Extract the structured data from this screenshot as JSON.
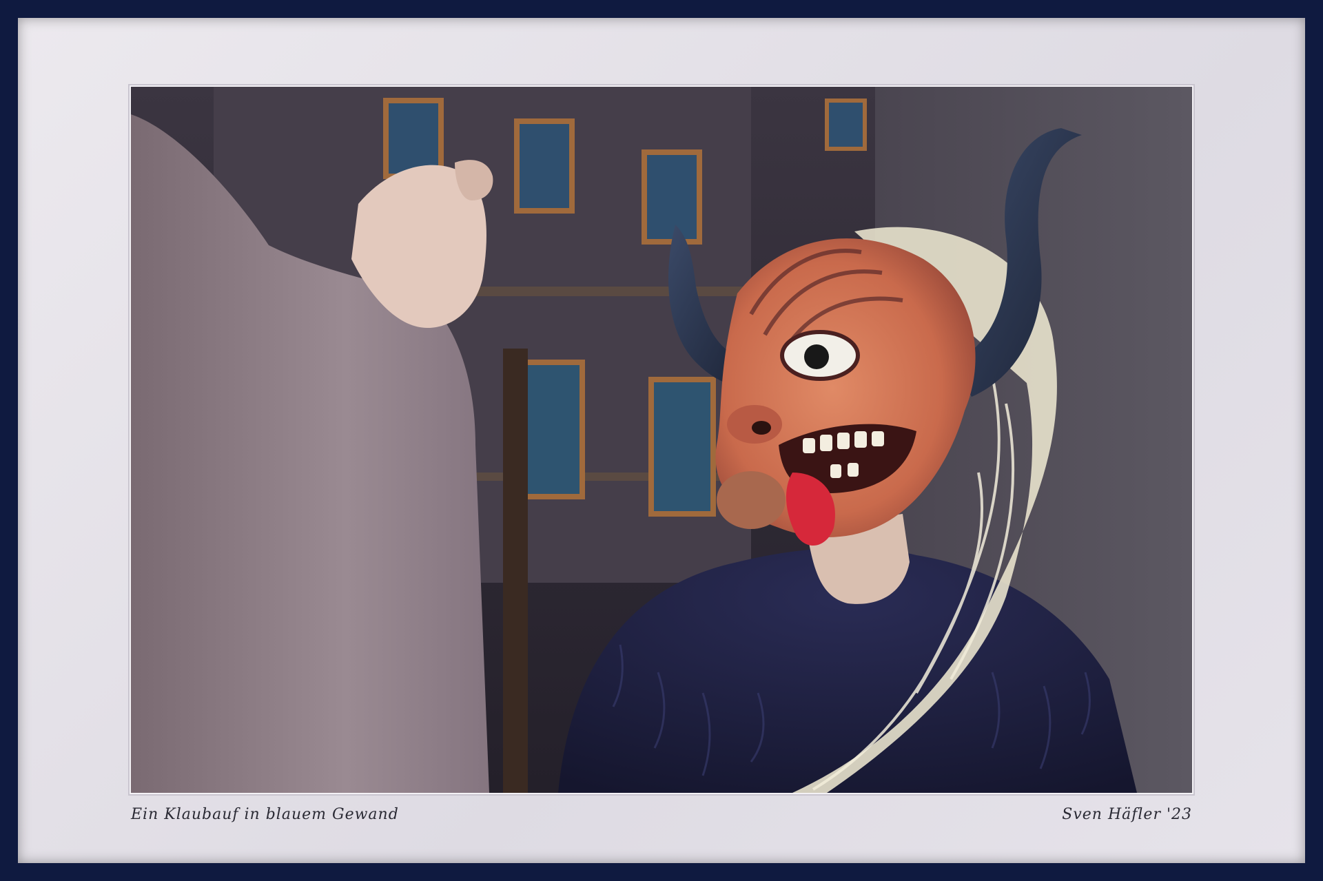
{
  "caption": {
    "title": "Ein Klaubauf in blauem Gewand",
    "signature": "Sven Häfler '23"
  },
  "colors": {
    "frame": "#0f1a40",
    "mat": "#e6e3ea",
    "sleeve": "#8e7d86",
    "mask": "#d9785a",
    "fur": "#1c1d3f",
    "hair": "#e9e4cf",
    "building": "#3a3440"
  }
}
